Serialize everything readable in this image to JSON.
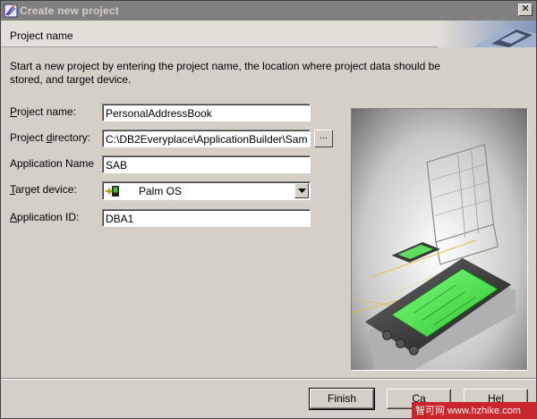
{
  "window": {
    "title": "Create new project",
    "close_symbol": "✕"
  },
  "header": {
    "heading": "Project name"
  },
  "intro_text": "Start a new project by entering the project name, the location where project data should be stored, and target device.",
  "form": {
    "project_name": {
      "label_pre": "",
      "label_key": "P",
      "label_post": "roject name:",
      "value": "PersonalAddressBook"
    },
    "project_directory": {
      "label_pre": "Project ",
      "label_key": "d",
      "label_post": "irectory:",
      "value": "C:\\DB2Everyplace\\ApplicationBuilder\\Sam"
    },
    "application_name": {
      "label": "Application Name",
      "value": "SAB"
    },
    "target_device": {
      "label_pre": "",
      "label_key": "T",
      "label_post": "arget device:",
      "value": "Palm OS",
      "icon": "palm-device-icon"
    },
    "application_id": {
      "label_pre": "",
      "label_key": "A",
      "label_post": "pplication ID:",
      "value": "DBA1"
    },
    "browse_label": "..."
  },
  "buttons": {
    "finish": "Finish",
    "cancel": "Ca",
    "help": "Hel"
  },
  "watermark": "智可网 www.hzhike.com"
}
